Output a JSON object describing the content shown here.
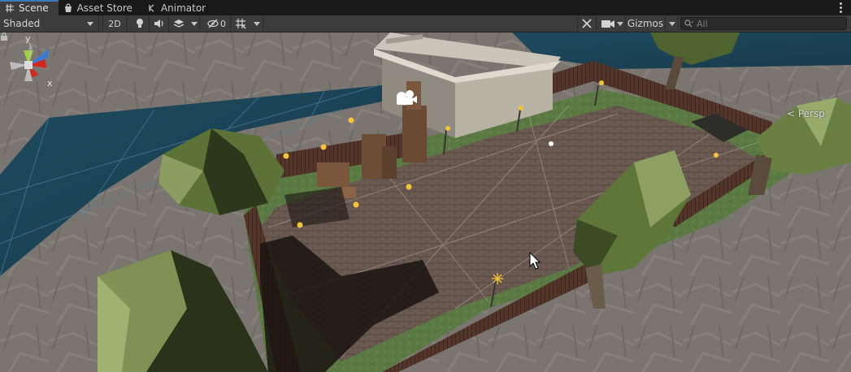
{
  "tabs": [
    {
      "label": "Scene",
      "icon": "grid-hash-icon",
      "active": true
    },
    {
      "label": "Asset Store",
      "icon": "shopping-bag-icon",
      "active": false
    },
    {
      "label": "Animator",
      "icon": "animator-branch-icon",
      "active": false
    }
  ],
  "toolbar": {
    "shading_mode": "Shaded",
    "mode_2d": "2D",
    "hidden_count": "0",
    "gizmos_label": "Gizmos",
    "search_placeholder": "All"
  },
  "viewport": {
    "projection_label": "< Persp",
    "axis_labels": {
      "y": "y",
      "x": "x"
    }
  },
  "colors": {
    "accent": "#3a79bb",
    "toolbar_bg": "#3c3c3c",
    "tab_bg": "#191919",
    "gizmo_y": "#9ed13f",
    "gizmo_x": "#d4261b",
    "gizmo_z": "#3b7bd6"
  }
}
